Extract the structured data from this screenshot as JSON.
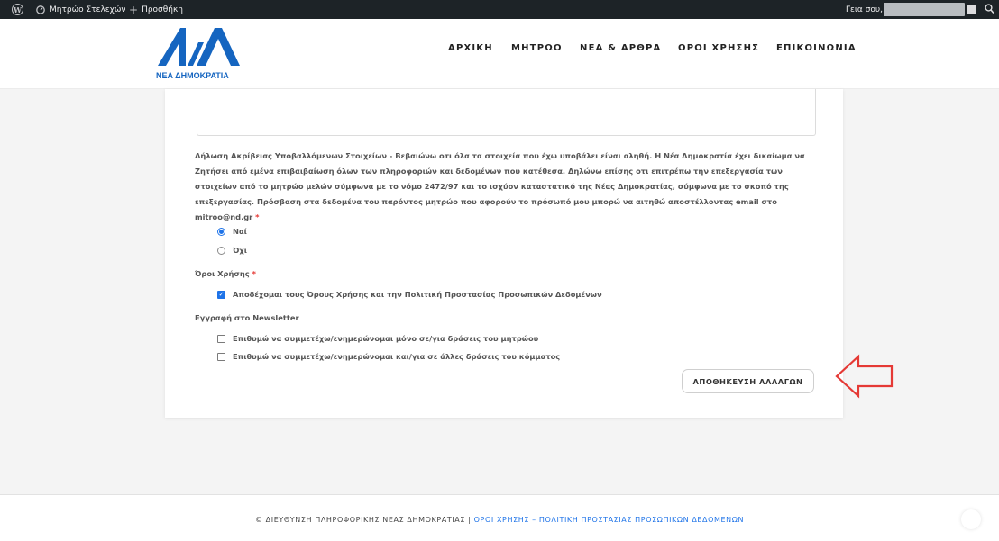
{
  "adminbar": {
    "site_name": "Μητρώο Στελεχών",
    "add_new": "Προσθήκη",
    "greeting": "Γεια σου,"
  },
  "header": {
    "logo_mark": "ΝΔ",
    "logo_text": "ΝΕΑ ΔΗΜΟΚΡΑΤΙΑ",
    "brand_color": "#1565c0",
    "nav": [
      "ΑΡΧΙΚΗ",
      "ΜΗΤΡΩΟ",
      "ΝΕΑ & ΑΡΘΡΑ",
      "ΟΡΟΙ ΧΡΗΣΗΣ",
      "ΕΠΙΚΟΙΝΩΝΙΑ"
    ]
  },
  "form": {
    "declaration_text": "Δήλωση Ακρίβειας Υποβαλλόμενων Στοιχείων - Βεβαιώνω οτι όλα τα στοιχεία που έχω υποβάλει είναι αληθή. Η Νέα Δημοκρατία έχει δικαίωμα να Ζητήσει από εμένα επιβαιβαίωση όλων των πληροφοριών και δεδομένων που κατέθεσα. Δηλώνω επίσης οτι επιτρέπω την επεξεργασία των στοιχείων από το μητρώο μελών σύμφωνα με το νόμο 2472/97 και το ισχύον καταστατικό της Νέας Δημοκρατίας, σύμφωνα με το σκοπό της επεξεργασίας. Πρόσβαση στα δεδομένα του παρόντος μητρώο που αφορούν το πρόσωπό μου μπορώ να αιτηθώ αποστέλλοντας email στο mitroo@nd.gr",
    "required_mark": "*",
    "declaration_options": [
      {
        "label": "Ναί",
        "selected": true
      },
      {
        "label": "Όχι",
        "selected": false
      }
    ],
    "terms_label": "Όροι Χρήσης",
    "terms_checkbox": {
      "label": "Αποδέχομαι τους Όρους Χρήσης και την Πολιτική Προστασίας Προσωπικών Δεδομένων",
      "checked": true
    },
    "newsletter_label": "Εγγραφή στο Newsletter",
    "newsletter_options": [
      {
        "label": "Επιθυμώ να συμμετέχω/ενημερώνομαι μόνο σε/για δράσεις του μητρώου",
        "checked": false
      },
      {
        "label": "Επιθυμώ να συμμετέχω/ενημερώνομαι και/για σε άλλες δράσεις του κόμματος",
        "checked": false
      }
    ],
    "save_label": "ΑΠΟΘΗΚΕΥΣΗ ΑΛΛΑΓΩΝ"
  },
  "annotation": {
    "color": "#e53935"
  },
  "footer": {
    "copyright": "© ΔΙΕΥΘΥΝΣΗ ΠΛΗΡΟΦΟΡΙΚΗΣ ΝΕΑΣ ΔΗΜΟΚΡΑΤΙΑΣ",
    "separator": "|",
    "terms_link": "ΟΡΟΙ ΧΡΗΣΗΣ",
    "dash": "–",
    "privacy_link": "ΠΟΛΙΤΙΚΗ ΠΡΟΣΤΑΣΙΑΣ ΠΡΟΣΩΠΙΚΩΝ ΔΕΔΟΜΕΝΩΝ",
    "link_color": "#1e73e8"
  }
}
